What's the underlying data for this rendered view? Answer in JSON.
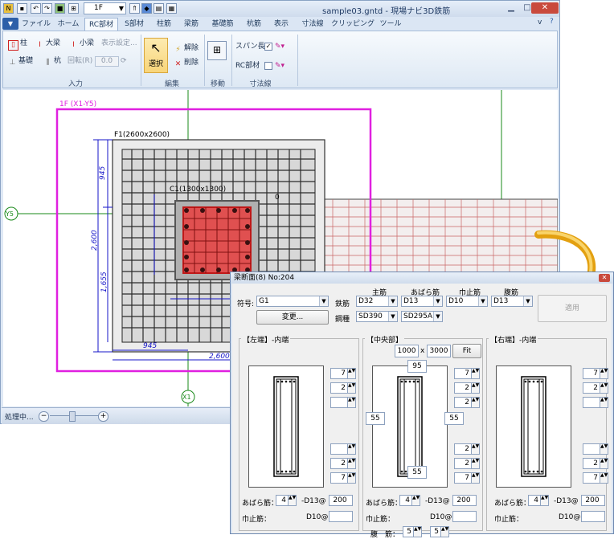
{
  "window": {
    "title": "sample03.gntd - 現場ナビ3D鉄筋",
    "floor": "1F",
    "menu_char": "v"
  },
  "tabs": [
    "ファイル",
    "ホーム",
    "RC部材",
    "S部材",
    "柱筋",
    "梁筋",
    "基礎筋",
    "杭筋",
    "表示",
    "寸法線",
    "クリッピング",
    "ツール"
  ],
  "ribbon": {
    "input": {
      "col": "柱",
      "big_beam": "大梁",
      "small_beam": "小梁",
      "display_settings": "表示設定...",
      "foundation": "基礎",
      "pile": "杭",
      "rotation": "回転(R)",
      "rotation_value": "0.0",
      "group": "入力"
    },
    "edit": {
      "select": "選択",
      "release": "解除",
      "delete": "削除",
      "group": "編集"
    },
    "move": {
      "group": "移動"
    },
    "dim": {
      "span_length": "スパン長",
      "rc_member": "RC部材",
      "group": "寸法線"
    }
  },
  "drawing": {
    "frame_label": "1F (X1-Y5)",
    "footing_label": "F1(2600x2600)",
    "column_label": "C1(1300x1300)",
    "dims": [
      "945",
      "2,600",
      "1,655",
      "945",
      "2,600"
    ],
    "axis_y": "Y5",
    "axis_x": "X1",
    "zero": "0"
  },
  "status": {
    "text": "処理中..."
  },
  "dialog": {
    "title": "梁断面(8) No:204",
    "sign_label": "符号:",
    "sign_value": "G1",
    "change_btn": "変更...",
    "rebar_label": "鉄筋",
    "steel_label": "鋼種",
    "heads": [
      "主筋",
      "あばら筋",
      "巾止筋",
      "腹筋"
    ],
    "rebar": [
      "D32",
      "D13",
      "D10",
      "D13"
    ],
    "steel": [
      "SD390",
      "SD295A"
    ],
    "apply_btn": "適用",
    "left_title": "【左端】-内端",
    "center_title": "【中央部】",
    "right_title": "【右端】-内端",
    "size_w": "1000",
    "size_x": "x",
    "size_h": "3000",
    "fit_btn": "Fit",
    "cover_top": "95",
    "cover_left": "55",
    "cover_right": "55",
    "cover_bottom": "55",
    "left_counts": [
      "7",
      "2",
      "",
      "",
      "2",
      "7"
    ],
    "center_counts": [
      "7",
      "2",
      "2",
      "2",
      "2",
      "7"
    ],
    "right_counts": [
      "7",
      "2",
      "",
      "",
      "2",
      "7"
    ],
    "stirrup_label": "あばら筋：",
    "stirrup_count": "4",
    "stirrup_dia": "-D13@",
    "stirrup_pitch": "200",
    "tie_label": "巾止筋：",
    "tie_dia": "D10@",
    "web_label": "腹　筋：",
    "web_a": "5",
    "web_b": "5"
  },
  "colors": {
    "frame": "#e020e0",
    "grid": "#1a8a1a",
    "rebar": "#c01818",
    "dim": "#1414c8"
  }
}
